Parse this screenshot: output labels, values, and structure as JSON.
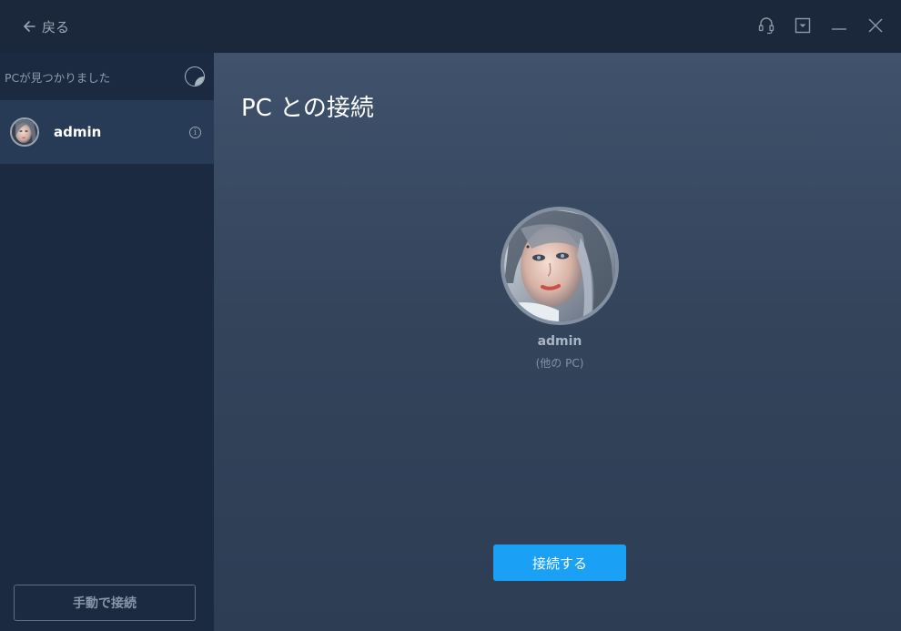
{
  "titlebar": {
    "back_label": "戻る",
    "icons": [
      "headset-icon",
      "minimize-to-tray-icon",
      "minimize-icon",
      "close-icon"
    ]
  },
  "sidebar": {
    "title": "PCが見つかりました",
    "items": [
      {
        "name": "admin"
      }
    ],
    "manual_connect_label": "手動で接続"
  },
  "main": {
    "title": "PC との接続",
    "pc_name": "admin",
    "pc_type": "(他の PC)",
    "connect_label": "接続する"
  },
  "colors": {
    "accent": "#1aa1f5",
    "sidebar_bg": "#1b2a40",
    "selected_item_bg": "#283b56"
  }
}
